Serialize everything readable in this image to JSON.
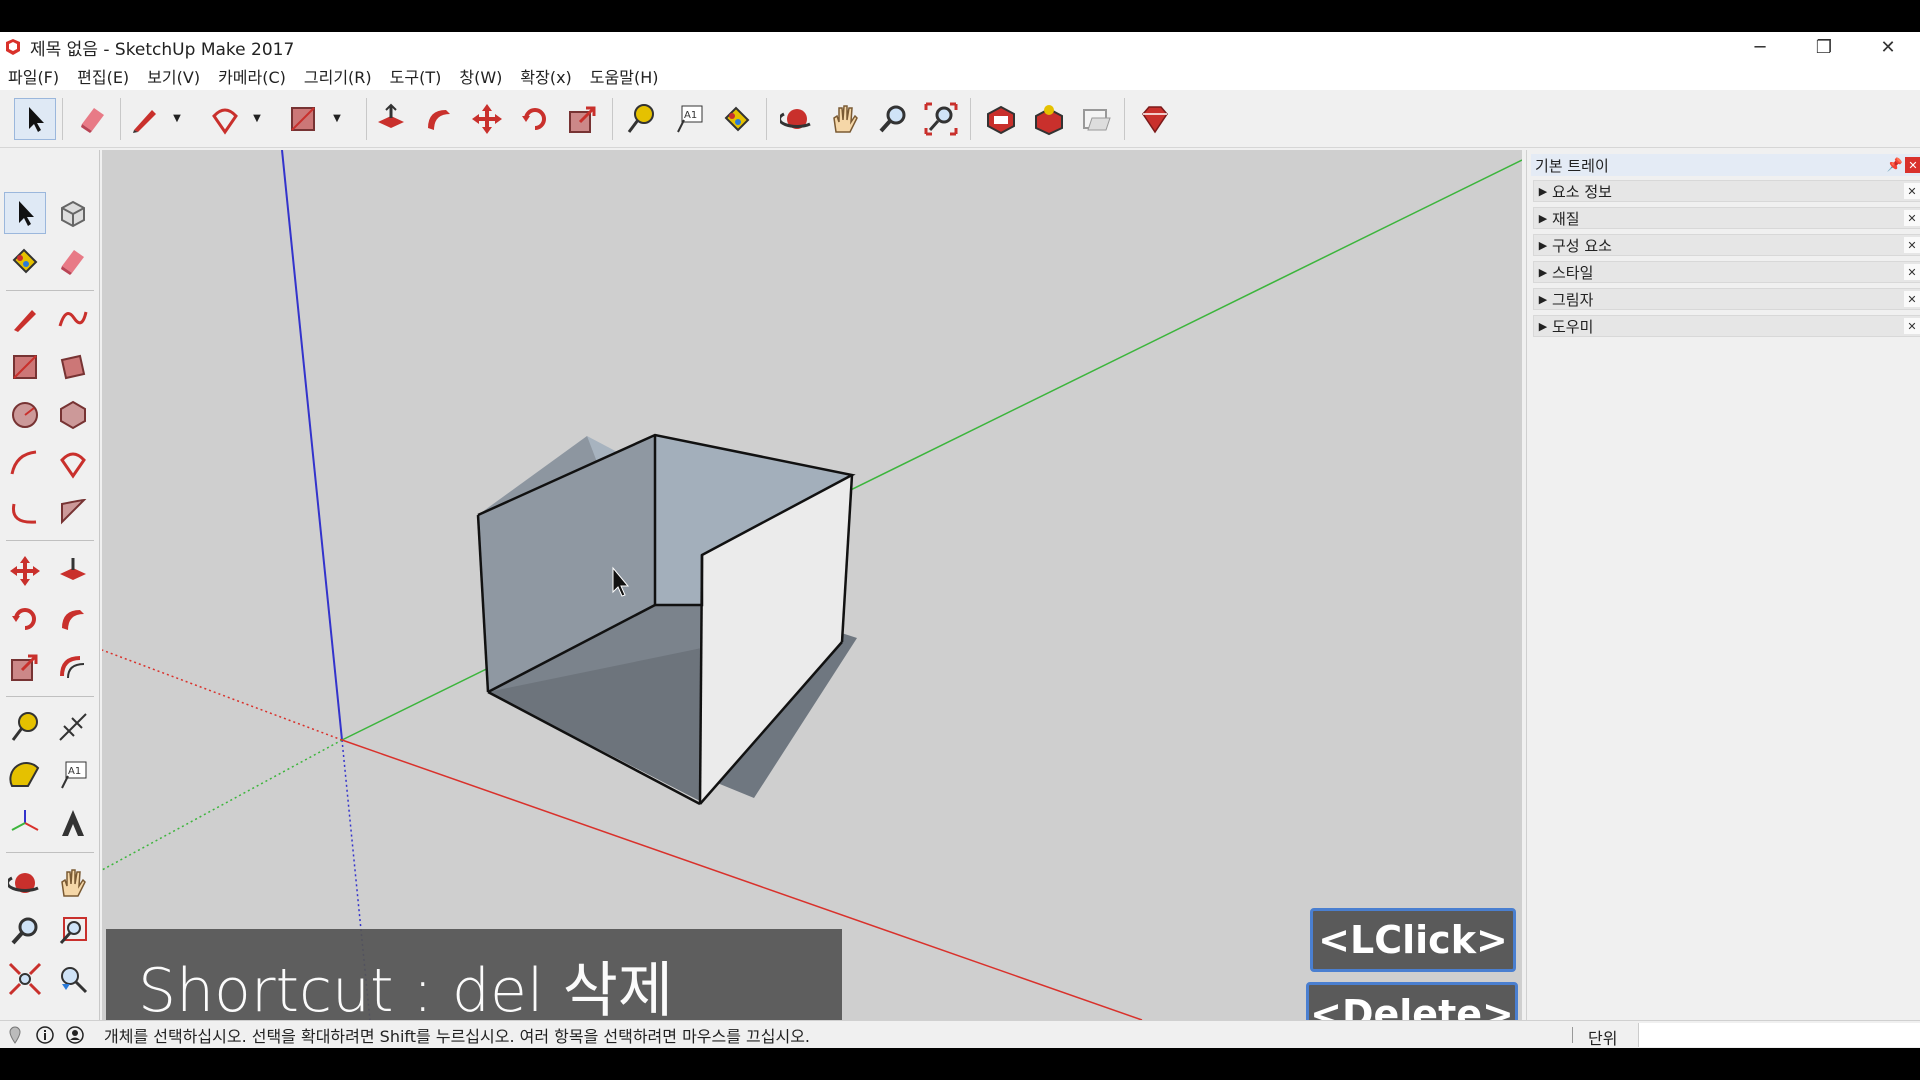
{
  "window": {
    "title": "제목 없음 - SketchUp Make 2017",
    "minimize": "─",
    "restore": "❐",
    "close": "✕"
  },
  "menu": [
    "파일(F)",
    "편집(E)",
    "보기(V)",
    "카메라(C)",
    "그리기(R)",
    "도구(T)",
    "창(W)",
    "확장(x)",
    "도움말(H)"
  ],
  "toolbar": {
    "icons": [
      "select-icon",
      "eraser-icon",
      "pencil-icon",
      "arc-icon",
      "rectangle-icon",
      "push-pull-icon",
      "follow-me-icon",
      "move-icon",
      "rotate-icon",
      "scale-icon",
      "tape-measure-icon",
      "text-icon",
      "paint-bucket-icon",
      "orbit-icon",
      "pan-icon",
      "zoom-icon",
      "zoom-extents-icon",
      "3d-warehouse-icon",
      "extension-warehouse-icon",
      "layout-icon",
      "ruby-icon"
    ]
  },
  "tray": {
    "title": "기본 트레이",
    "pin": "📌",
    "close": "✕",
    "panels": [
      "요소 정보",
      "재질",
      "구성 요소",
      "스타일",
      "그림자",
      "도우미"
    ]
  },
  "overlay": {
    "shortcut": "Shortcut : del 삭제",
    "key1": "<LClick>",
    "key2": "<Delete>"
  },
  "status": {
    "message": "개체를 선택하십시오. 선택을 확대하려면 Shift를 누르십시오. 여러 항목을 선택하려면 마우스를 끄십시오.",
    "unit_label": "단위",
    "unit_value": ""
  },
  "colors": {
    "axis_red": "#d9312b",
    "axis_green": "#3cb53c",
    "axis_blue": "#3333cc",
    "background": "#cfcfcf",
    "key_border": "#4a7fd0"
  }
}
